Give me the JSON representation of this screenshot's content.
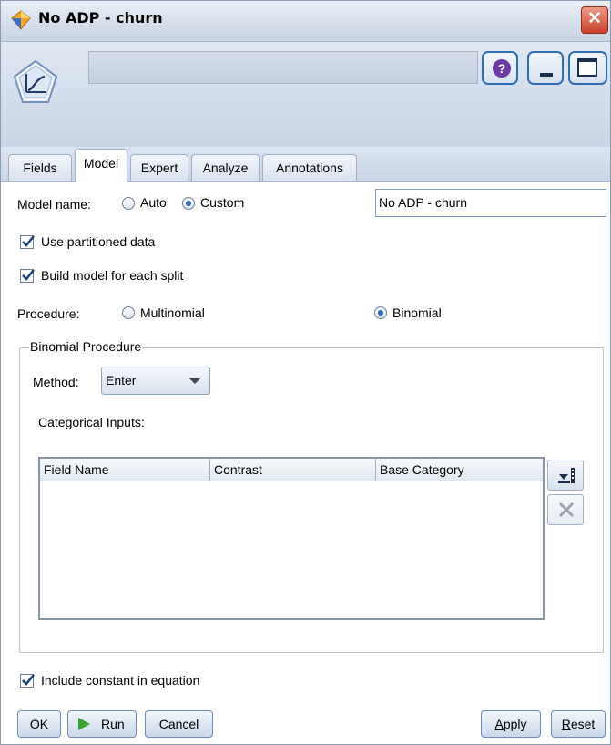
{
  "window": {
    "title": "No ADP - churn"
  },
  "header": {
    "icon": "logistic-model-node-icon",
    "help_icon": "help-icon",
    "help_label": "?"
  },
  "tabs": [
    {
      "label": "Fields",
      "active": false
    },
    {
      "label": "Model",
      "active": true
    },
    {
      "label": "Expert",
      "active": false
    },
    {
      "label": "Analyze",
      "active": false
    },
    {
      "label": "Annotations",
      "active": false
    }
  ],
  "model": {
    "model_name_label": "Model name:",
    "auto_label": "Auto",
    "custom_label": "Custom",
    "selected_name_mode": "Custom",
    "model_name_value": "No ADP - churn",
    "use_partitioned_label": "Use partitioned data",
    "use_partitioned_checked": true,
    "build_each_split_label": "Build model for each split",
    "build_each_split_checked": true,
    "procedure_label": "Procedure:",
    "multinomial_label": "Multinomial",
    "binomial_label": "Binomial",
    "selected_procedure": "Binomial"
  },
  "binomial": {
    "group_title": "Binomial Procedure",
    "method_label": "Method:",
    "method_value": "Enter",
    "categorical_inputs_label": "Categorical Inputs:",
    "columns": [
      "Field Name",
      "Contrast",
      "Base Category"
    ],
    "rows": []
  },
  "footer": {
    "include_constant_label": "Include constant in equation",
    "include_constant_checked": true,
    "ok_label": "OK",
    "run_label": "Run",
    "cancel_label": "Cancel",
    "apply_label_pre": "",
    "apply_label_ul": "A",
    "apply_label_post": "pply",
    "reset_label_pre": "",
    "reset_label_ul": "R",
    "reset_label_post": "eset"
  },
  "colors": {
    "title_bg": "#c8d3e3",
    "close_red": "#c8412a",
    "radio_dot": "#2d67b8",
    "run_green": "#3aa035",
    "accent_blue": "#2c6db6"
  }
}
